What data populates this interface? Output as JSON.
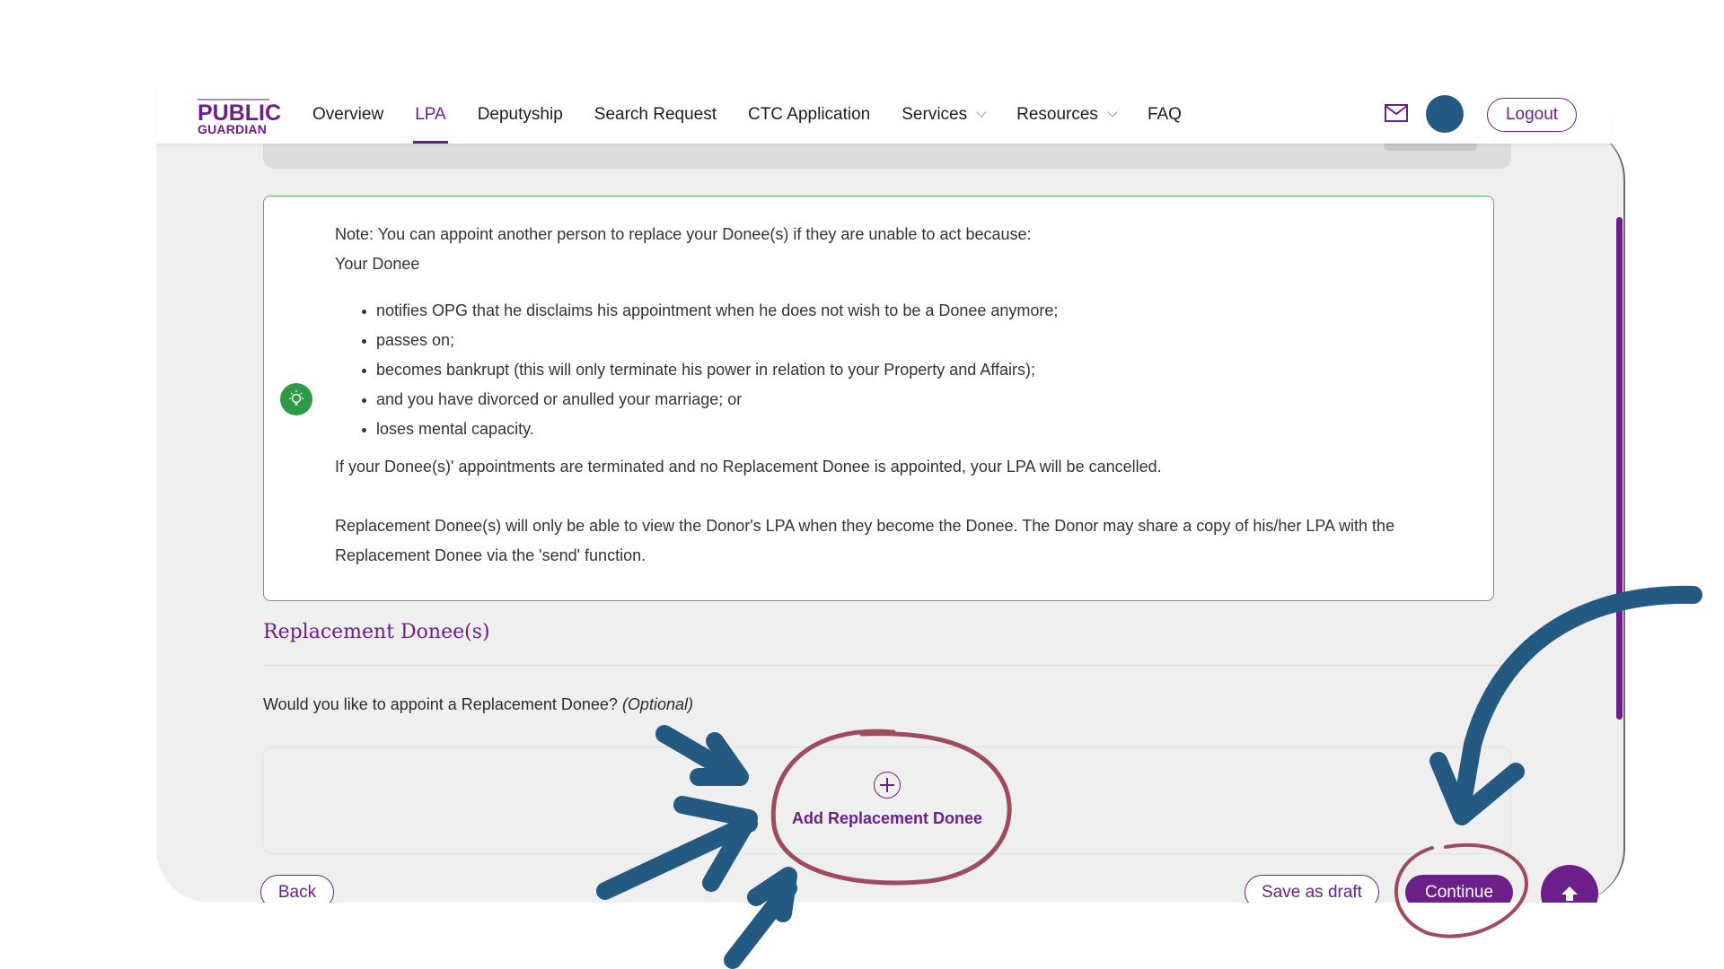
{
  "header": {
    "logo": {
      "line1": "PUBLIC",
      "line2": "GUARDIAN"
    },
    "nav": [
      {
        "label": "Overview",
        "active": false,
        "dropdown": false
      },
      {
        "label": "LPA",
        "active": true,
        "dropdown": false
      },
      {
        "label": "Deputyship",
        "active": false,
        "dropdown": false
      },
      {
        "label": "Search Request",
        "active": false,
        "dropdown": false
      },
      {
        "label": "CTC Application",
        "active": false,
        "dropdown": false
      },
      {
        "label": "Services",
        "active": false,
        "dropdown": true
      },
      {
        "label": "Resources",
        "active": false,
        "dropdown": true
      },
      {
        "label": "FAQ",
        "active": false,
        "dropdown": false
      }
    ],
    "mail_icon": "mail-icon",
    "avatar_color": "#245a82",
    "logout_label": "Logout"
  },
  "note": {
    "icon": "lightbulb-icon",
    "intro": "Note: You can appoint another person to replace your Donee(s) if they are unable to act because:",
    "subject": "Your Donee",
    "bullets": [
      "notifies OPG that he disclaims his appointment when he does not wish to be a Donee anymore;",
      "passes on;",
      "becomes bankrupt (this will only terminate his power in relation to your Property and Affairs);",
      "and you have divorced or anulled your marriage; or",
      "loses mental capacity."
    ],
    "termination": "If your Donee(s)' appointments are terminated and no Replacement Donee is appointed, your LPA will be cancelled.",
    "visibility": "Replacement Donee(s) will only be able to view the Donor's LPA when they become the Donee. The Donor may share a copy of his/her LPA with the Replacement Donee via the 'send' function."
  },
  "section": {
    "title": "Replacement Donee(s)",
    "question": "Would you like to appoint a Replacement Donee?",
    "optional": "(Optional)",
    "add_label": "Add Replacement Donee",
    "add_icon": "plus-circle-icon"
  },
  "footer": {
    "back_label": "Back",
    "draft_label": "Save as draft",
    "continue_label": "Continue",
    "top_icon": "arrow-up-icon"
  },
  "colors": {
    "brand": "#6c1f8a",
    "note_border": "#5aaf5a",
    "bulb": "#2e9a46",
    "annotation_arrow": "#245a82",
    "annotation_circle": "#a04a5e"
  }
}
